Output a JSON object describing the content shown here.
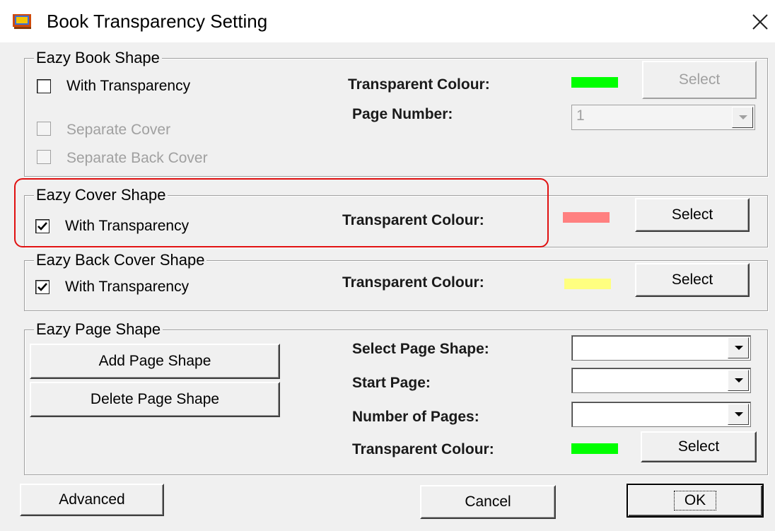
{
  "window": {
    "title": "Book Transparency Setting",
    "icon": "app-icon",
    "close_icon": "close-icon"
  },
  "book_shape": {
    "legend": "Eazy Book Shape",
    "with_transparency": {
      "label": "With Transparency",
      "checked": false
    },
    "transparent_colour_label": "Transparent Colour:",
    "colour": "#00ff00",
    "select_label": "Select",
    "page_number_label": "Page Number:",
    "page_number_value": "1",
    "separate_cover": {
      "label": "Separate Cover",
      "checked": false,
      "enabled": false
    },
    "separate_back_cover": {
      "label": "Separate Back Cover",
      "checked": false,
      "enabled": false
    }
  },
  "cover_shape": {
    "legend": "Eazy Cover Shape",
    "with_transparency": {
      "label": "With Transparency",
      "checked": true
    },
    "transparent_colour_label": "Transparent Colour:",
    "colour": "#ff8080",
    "select_label": "Select",
    "highlight_color": "#e01010"
  },
  "back_cover_shape": {
    "legend": "Eazy Back Cover Shape",
    "with_transparency": {
      "label": "With Transparency",
      "checked": true
    },
    "transparent_colour_label": "Transparent Colour:",
    "colour": "#ffff80",
    "select_label": "Select"
  },
  "page_shape": {
    "legend": "Eazy Page Shape",
    "add_label": "Add Page Shape",
    "delete_label": "Delete Page Shape",
    "select_page_shape_label": "Select Page Shape:",
    "start_page_label": "Start Page:",
    "number_of_pages_label": "Number of Pages:",
    "transparent_colour_label": "Transparent Colour:",
    "colour": "#00ff00",
    "select_label": "Select"
  },
  "footer": {
    "advanced_label": "Advanced",
    "cancel_label": "Cancel",
    "ok_label": "OK"
  }
}
